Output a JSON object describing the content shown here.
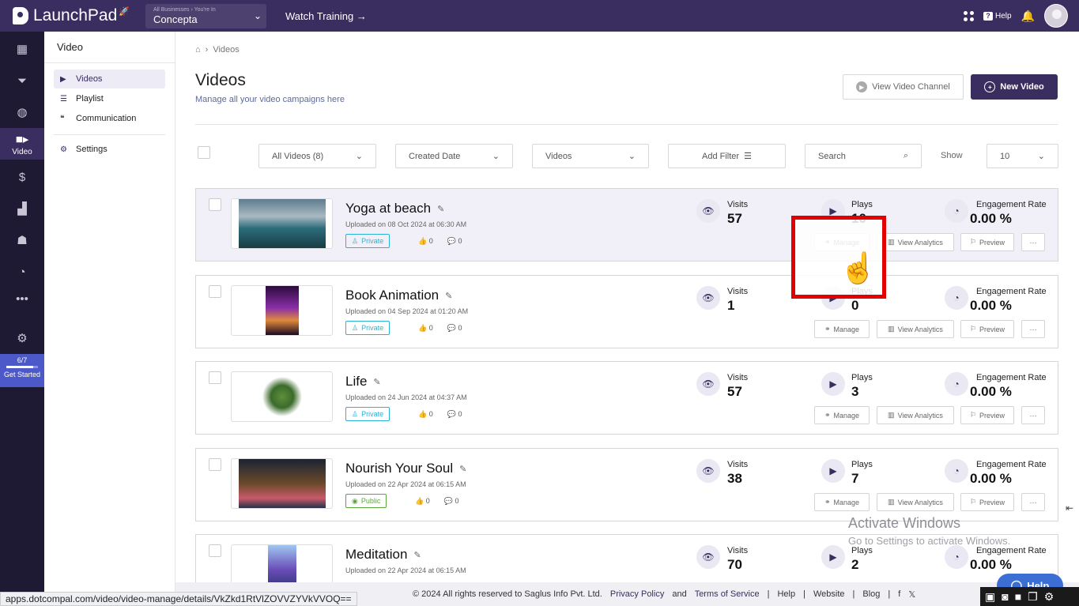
{
  "app": {
    "brand": "LaunchPad",
    "business_switch": {
      "small": "All Businesses › You're In",
      "name": "Concepta"
    },
    "watch_training": "Watch Training →",
    "help_label": "Help"
  },
  "rail": {
    "active_label": "Video",
    "get_started": {
      "progress_text": "6/7",
      "progress_fraction": 0.857,
      "label": "Get Started"
    }
  },
  "subnav": {
    "title": "Video",
    "items": [
      {
        "label": "Videos",
        "icon": "video-icon",
        "active": true
      },
      {
        "label": "Playlist",
        "icon": "playlist-icon",
        "active": false
      },
      {
        "label": "Communication",
        "icon": "communication-icon",
        "active": false
      }
    ],
    "settings_label": "Settings"
  },
  "breadcrumb": {
    "current": "Videos"
  },
  "page": {
    "title": "Videos",
    "subtitle": "Manage all your video campaigns here",
    "view_channel_label": "View Video Channel",
    "new_video_label": "New Video"
  },
  "filters": {
    "all_videos": "All Videos (8)",
    "created_date": "Created Date",
    "type": "Videos",
    "add_filter": "Add Filter",
    "search_placeholder": "Search",
    "show_label": "Show",
    "show_value": "10"
  },
  "stat_labels": {
    "visits": "Visits",
    "plays": "Plays",
    "engagement": "Engagement Rate"
  },
  "actions": {
    "manage": "Manage",
    "analytics": "View Analytics",
    "preview": "Preview",
    "more": "···"
  },
  "videos": [
    {
      "title": "Yoga at beach",
      "uploaded": "Uploaded on 08 Oct 2024 at 06:30 AM",
      "visibility": "Private",
      "likes": "0",
      "comments": "0",
      "visits": "57",
      "plays": "10",
      "engagement": "0.00 %"
    },
    {
      "title": "Book Animation",
      "uploaded": "Uploaded on 04 Sep 2024 at 01:20 AM",
      "visibility": "Private",
      "likes": "0",
      "comments": "0",
      "visits": "1",
      "plays": "0",
      "engagement": "0.00 %"
    },
    {
      "title": "Life",
      "uploaded": "Uploaded on 24 Jun 2024 at 04:37 AM",
      "visibility": "Private",
      "likes": "0",
      "comments": "0",
      "visits": "57",
      "plays": "3",
      "engagement": "0.00 %"
    },
    {
      "title": "Nourish Your Soul",
      "uploaded": "Uploaded on 22 Apr 2024 at 06:15 AM",
      "visibility": "Public",
      "likes": "0",
      "comments": "0",
      "visits": "38",
      "plays": "7",
      "engagement": "0.00 %"
    },
    {
      "title": "Meditation",
      "uploaded": "Uploaded on 22 Apr 2024 at 06:15 AM",
      "visibility": "",
      "likes": "",
      "comments": "",
      "visits": "70",
      "plays": "2",
      "engagement": "0.00 %"
    }
  ],
  "footer": {
    "copyright": "© 2024 All rights reserved to Saglus Info Pvt. Ltd.",
    "privacy": "Privacy Policy",
    "and": "and",
    "terms": "Terms of Service",
    "help": "Help",
    "website": "Website",
    "blog": "Blog"
  },
  "status_url": "apps.dotcompal.com/video/video-manage/details/VkZkd1RtVlZOVVZYVkVVOQ==",
  "watermark": {
    "line1": "Activate Windows",
    "line2": "Go to Settings to activate Windows."
  },
  "help_fab": "Help",
  "colors": {
    "brand": "#3a2d60",
    "private": "#2bb3d6",
    "public": "#5aa83c",
    "highlight": "#e30000"
  }
}
